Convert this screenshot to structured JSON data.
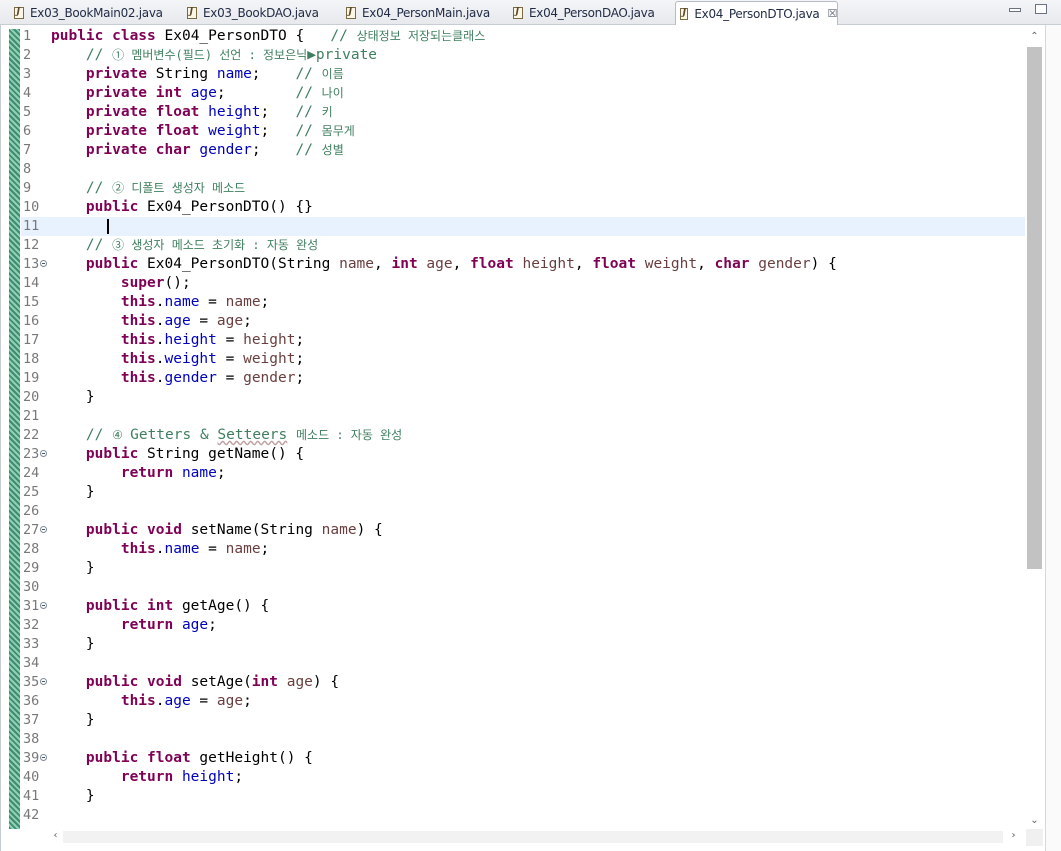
{
  "tabs": [
    {
      "label": "Ex03_BookMain02.java",
      "active": false
    },
    {
      "label": "Ex03_BookDAO.java",
      "active": false
    },
    {
      "label": "Ex04_PersonMain.java",
      "active": false
    },
    {
      "label": "Ex04_PersonDAO.java",
      "active": false
    },
    {
      "label": "Ex04_PersonDTO.java",
      "active": true
    }
  ],
  "tab_close_glyph": "☒",
  "editor": {
    "current_line": 11,
    "lines": [
      {
        "n": "1",
        "fold": false,
        "tokens": [
          [
            "kw",
            "public class "
          ],
          [
            "pl",
            "Ex04_PersonDTO {   "
          ],
          [
            "cm",
            "// "
          ],
          [
            "cm ko",
            "상태정보 저장되는클래스"
          ]
        ]
      },
      {
        "n": "2",
        "fold": false,
        "tokens": [
          [
            "pl",
            "    "
          ],
          [
            "cm",
            "// "
          ],
          [
            "cm ko",
            "① 멤버변수(필드) 선언 : 정보은닉"
          ],
          [
            "cm",
            "▶private"
          ]
        ]
      },
      {
        "n": "3",
        "fold": false,
        "tokens": [
          [
            "pl",
            "    "
          ],
          [
            "kw",
            "private "
          ],
          [
            "pl",
            "String "
          ],
          [
            "fld",
            "name"
          ],
          [
            "pl",
            ";    "
          ],
          [
            "cm",
            "// "
          ],
          [
            "cm ko",
            "이름"
          ]
        ]
      },
      {
        "n": "4",
        "fold": false,
        "tokens": [
          [
            "pl",
            "    "
          ],
          [
            "kw",
            "private int "
          ],
          [
            "fld",
            "age"
          ],
          [
            "pl",
            ";        "
          ],
          [
            "cm",
            "// "
          ],
          [
            "cm ko",
            "나이"
          ]
        ]
      },
      {
        "n": "5",
        "fold": false,
        "tokens": [
          [
            "pl",
            "    "
          ],
          [
            "kw",
            "private float "
          ],
          [
            "fld",
            "height"
          ],
          [
            "pl",
            ";   "
          ],
          [
            "cm",
            "// "
          ],
          [
            "cm ko",
            "키"
          ]
        ]
      },
      {
        "n": "6",
        "fold": false,
        "tokens": [
          [
            "pl",
            "    "
          ],
          [
            "kw",
            "private float "
          ],
          [
            "fld",
            "weight"
          ],
          [
            "pl",
            ";   "
          ],
          [
            "cm",
            "// "
          ],
          [
            "cm ko",
            "몸무게"
          ]
        ]
      },
      {
        "n": "7",
        "fold": false,
        "tokens": [
          [
            "pl",
            "    "
          ],
          [
            "kw",
            "private char "
          ],
          [
            "fld",
            "gender"
          ],
          [
            "pl",
            ";    "
          ],
          [
            "cm",
            "// "
          ],
          [
            "cm ko",
            "성별"
          ]
        ]
      },
      {
        "n": "8",
        "fold": false,
        "tokens": []
      },
      {
        "n": "9",
        "fold": false,
        "tokens": [
          [
            "pl",
            "    "
          ],
          [
            "cm",
            "// "
          ],
          [
            "cm ko",
            "② 디폴트 생성자 메소드"
          ]
        ]
      },
      {
        "n": "10",
        "fold": false,
        "tokens": [
          [
            "pl",
            "    "
          ],
          [
            "kw",
            "public "
          ],
          [
            "pl",
            "Ex04_PersonDTO() {}"
          ]
        ]
      },
      {
        "n": "11",
        "fold": false,
        "tokens": []
      },
      {
        "n": "12",
        "fold": false,
        "tokens": [
          [
            "pl",
            "    "
          ],
          [
            "cm",
            "// "
          ],
          [
            "cm ko",
            "③ 생성자 메소드 초기화 : 자동 완성"
          ]
        ]
      },
      {
        "n": "13",
        "fold": true,
        "tokens": [
          [
            "pl",
            "    "
          ],
          [
            "kw",
            "public "
          ],
          [
            "pl",
            "Ex04_PersonDTO(String "
          ],
          [
            "par",
            "name"
          ],
          [
            "pl",
            ", "
          ],
          [
            "kw",
            "int "
          ],
          [
            "par",
            "age"
          ],
          [
            "pl",
            ", "
          ],
          [
            "kw",
            "float "
          ],
          [
            "par",
            "height"
          ],
          [
            "pl",
            ", "
          ],
          [
            "kw",
            "float "
          ],
          [
            "par",
            "weight"
          ],
          [
            "pl",
            ", "
          ],
          [
            "kw",
            "char "
          ],
          [
            "par",
            "gender"
          ],
          [
            "pl",
            ") {"
          ]
        ]
      },
      {
        "n": "14",
        "fold": false,
        "tokens": [
          [
            "pl",
            "        "
          ],
          [
            "kw",
            "super"
          ],
          [
            "pl",
            "();"
          ]
        ]
      },
      {
        "n": "15",
        "fold": false,
        "tokens": [
          [
            "pl",
            "        "
          ],
          [
            "kw",
            "this"
          ],
          [
            "pl",
            "."
          ],
          [
            "fld",
            "name"
          ],
          [
            "pl",
            " = "
          ],
          [
            "par",
            "name"
          ],
          [
            "pl",
            ";"
          ]
        ]
      },
      {
        "n": "16",
        "fold": false,
        "tokens": [
          [
            "pl",
            "        "
          ],
          [
            "kw",
            "this"
          ],
          [
            "pl",
            "."
          ],
          [
            "fld",
            "age"
          ],
          [
            "pl",
            " = "
          ],
          [
            "par",
            "age"
          ],
          [
            "pl",
            ";"
          ]
        ]
      },
      {
        "n": "17",
        "fold": false,
        "tokens": [
          [
            "pl",
            "        "
          ],
          [
            "kw",
            "this"
          ],
          [
            "pl",
            "."
          ],
          [
            "fld",
            "height"
          ],
          [
            "pl",
            " = "
          ],
          [
            "par",
            "height"
          ],
          [
            "pl",
            ";"
          ]
        ]
      },
      {
        "n": "18",
        "fold": false,
        "tokens": [
          [
            "pl",
            "        "
          ],
          [
            "kw",
            "this"
          ],
          [
            "pl",
            "."
          ],
          [
            "fld",
            "weight"
          ],
          [
            "pl",
            " = "
          ],
          [
            "par",
            "weight"
          ],
          [
            "pl",
            ";"
          ]
        ]
      },
      {
        "n": "19",
        "fold": false,
        "tokens": [
          [
            "pl",
            "        "
          ],
          [
            "kw",
            "this"
          ],
          [
            "pl",
            "."
          ],
          [
            "fld",
            "gender"
          ],
          [
            "pl",
            " = "
          ],
          [
            "par",
            "gender"
          ],
          [
            "pl",
            ";"
          ]
        ]
      },
      {
        "n": "20",
        "fold": false,
        "tokens": [
          [
            "pl",
            "    }"
          ]
        ]
      },
      {
        "n": "21",
        "fold": false,
        "tokens": []
      },
      {
        "n": "22",
        "fold": false,
        "tokens": [
          [
            "pl",
            "    "
          ],
          [
            "cm",
            "// "
          ],
          [
            "cm ko",
            "④ "
          ],
          [
            "cm",
            "Getters & "
          ],
          [
            "cm sq",
            "Setteers"
          ],
          [
            "cm",
            " "
          ],
          [
            "cm ko",
            "메소드 : 자동 완성"
          ]
        ]
      },
      {
        "n": "23",
        "fold": true,
        "tokens": [
          [
            "pl",
            "    "
          ],
          [
            "kw",
            "public "
          ],
          [
            "pl",
            "String getName() {"
          ]
        ]
      },
      {
        "n": "24",
        "fold": false,
        "tokens": [
          [
            "pl",
            "        "
          ],
          [
            "kw",
            "return "
          ],
          [
            "fld",
            "name"
          ],
          [
            "pl",
            ";"
          ]
        ]
      },
      {
        "n": "25",
        "fold": false,
        "tokens": [
          [
            "pl",
            "    }"
          ]
        ]
      },
      {
        "n": "26",
        "fold": false,
        "tokens": []
      },
      {
        "n": "27",
        "fold": true,
        "tokens": [
          [
            "pl",
            "    "
          ],
          [
            "kw",
            "public void "
          ],
          [
            "pl",
            "setName(String "
          ],
          [
            "par",
            "name"
          ],
          [
            "pl",
            ") {"
          ]
        ]
      },
      {
        "n": "28",
        "fold": false,
        "tokens": [
          [
            "pl",
            "        "
          ],
          [
            "kw",
            "this"
          ],
          [
            "pl",
            "."
          ],
          [
            "fld",
            "name"
          ],
          [
            "pl",
            " = "
          ],
          [
            "par",
            "name"
          ],
          [
            "pl",
            ";"
          ]
        ]
      },
      {
        "n": "29",
        "fold": false,
        "tokens": [
          [
            "pl",
            "    }"
          ]
        ]
      },
      {
        "n": "30",
        "fold": false,
        "tokens": []
      },
      {
        "n": "31",
        "fold": true,
        "tokens": [
          [
            "pl",
            "    "
          ],
          [
            "kw",
            "public int "
          ],
          [
            "pl",
            "getAge() {"
          ]
        ]
      },
      {
        "n": "32",
        "fold": false,
        "tokens": [
          [
            "pl",
            "        "
          ],
          [
            "kw",
            "return "
          ],
          [
            "fld",
            "age"
          ],
          [
            "pl",
            ";"
          ]
        ]
      },
      {
        "n": "33",
        "fold": false,
        "tokens": [
          [
            "pl",
            "    }"
          ]
        ]
      },
      {
        "n": "34",
        "fold": false,
        "tokens": []
      },
      {
        "n": "35",
        "fold": true,
        "tokens": [
          [
            "pl",
            "    "
          ],
          [
            "kw",
            "public void "
          ],
          [
            "pl",
            "setAge("
          ],
          [
            "kw",
            "int "
          ],
          [
            "par",
            "age"
          ],
          [
            "pl",
            ") {"
          ]
        ]
      },
      {
        "n": "36",
        "fold": false,
        "tokens": [
          [
            "pl",
            "        "
          ],
          [
            "kw",
            "this"
          ],
          [
            "pl",
            "."
          ],
          [
            "fld",
            "age"
          ],
          [
            "pl",
            " = "
          ],
          [
            "par",
            "age"
          ],
          [
            "pl",
            ";"
          ]
        ]
      },
      {
        "n": "37",
        "fold": false,
        "tokens": [
          [
            "pl",
            "    }"
          ]
        ]
      },
      {
        "n": "38",
        "fold": false,
        "tokens": []
      },
      {
        "n": "39",
        "fold": true,
        "tokens": [
          [
            "pl",
            "    "
          ],
          [
            "kw",
            "public float "
          ],
          [
            "pl",
            "getHeight() {"
          ]
        ]
      },
      {
        "n": "40",
        "fold": false,
        "tokens": [
          [
            "pl",
            "        "
          ],
          [
            "kw",
            "return "
          ],
          [
            "fld",
            "height"
          ],
          [
            "pl",
            ";"
          ]
        ]
      },
      {
        "n": "41",
        "fold": false,
        "tokens": [
          [
            "pl",
            "    }"
          ]
        ]
      },
      {
        "n": "42",
        "fold": false,
        "tokens": []
      }
    ]
  }
}
